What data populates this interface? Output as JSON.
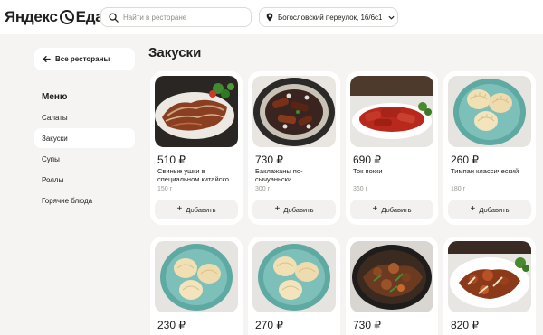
{
  "header": {
    "logo_part1": "Яндекс",
    "logo_part2": "Еда",
    "search_placeholder": "Найти в ресторане",
    "address": "Богословский переулок, 16/6с1"
  },
  "sidebar": {
    "back_label": "Все рестораны",
    "menu_title": "Меню",
    "items": [
      {
        "label": "Салаты"
      },
      {
        "label": "Закуски"
      },
      {
        "label": "Супы"
      },
      {
        "label": "Роллы"
      },
      {
        "label": "Горячие блюда"
      }
    ],
    "active_item": "Закуски"
  },
  "section": {
    "title": "Закуски"
  },
  "add_label": "Добавить",
  "products": [
    {
      "price": "510 ₽",
      "name": "Свиные ушки в специальном китайско...",
      "weight": "150 г",
      "image": "sliced-pork-ears"
    },
    {
      "price": "730 ₽",
      "name": "Баклажаны по-сычуаньски",
      "weight": "300 г",
      "image": "sichuan-eggplant"
    },
    {
      "price": "690 ₽",
      "name": "Ток покки",
      "weight": "360 г",
      "image": "tteokbokki"
    },
    {
      "price": "260 ₽",
      "name": "Тимпан классический",
      "weight": "180 г",
      "image": "steamed-dumplings"
    },
    {
      "price": "230 ₽",
      "image": "steamed-dumplings"
    },
    {
      "price": "270 ₽",
      "image": "steamed-dumplings"
    },
    {
      "price": "730 ₽",
      "image": "sizzling-plate"
    },
    {
      "price": "820 ₽",
      "image": "stir-fry-plate"
    }
  ],
  "colors": {
    "page_bg": "#f5f4f2",
    "card_bg": "#ffffff",
    "button_bg": "#f2f1ef",
    "text": "#21201f",
    "muted": "#9a9894"
  }
}
